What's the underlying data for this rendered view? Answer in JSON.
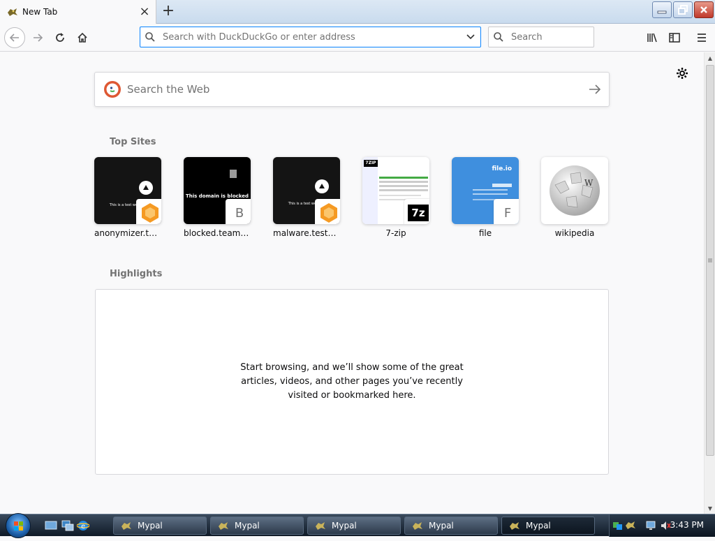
{
  "tab": {
    "title": "New Tab"
  },
  "nav": {
    "url_placeholder": "Search with DuckDuckGo or enter address",
    "search_placeholder": "Search"
  },
  "newtab": {
    "web_search_placeholder": "Search the Web",
    "top_sites_heading": "Top Sites",
    "top_sites": [
      {
        "label": "anonymizer.test...",
        "badge": ""
      },
      {
        "label": "blocked.teams.c...",
        "badge": "B"
      },
      {
        "label": "malware.testcat...",
        "badge": ""
      },
      {
        "label": "7-zip",
        "badge": ""
      },
      {
        "label": "file",
        "badge": "F"
      },
      {
        "label": "wikipedia",
        "badge": ""
      }
    ],
    "tile_texts": {
      "test_site": "This is a test website",
      "blocked": "This domain is blocked",
      "fileio": "file.io",
      "sevenzip_logo": "7ZIP",
      "sevenzip_badge": "7z",
      "wikipedia_glyph": "W"
    },
    "highlights_heading": "Highlights",
    "highlights_message": "Start browsing, and we’ll show some of the great articles, videos, and other pages you’ve recently visited or bookmarked here."
  },
  "taskbar": {
    "buttons": [
      {
        "label": "Mypal"
      },
      {
        "label": "Mypal"
      },
      {
        "label": "Mypal"
      },
      {
        "label": "Mypal"
      },
      {
        "label": "Mypal"
      }
    ],
    "clock": "3:43 PM"
  },
  "colors": {
    "accent": "#0a84ff",
    "ddg_orange": "#de5833",
    "tile_dark": "#141414",
    "file_blue": "#3f8fde"
  }
}
